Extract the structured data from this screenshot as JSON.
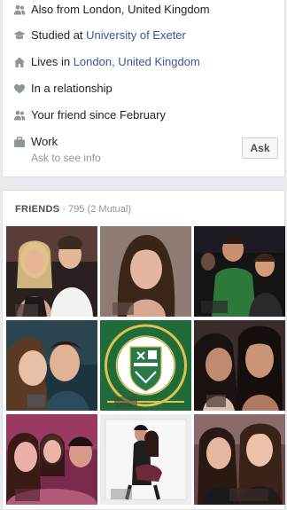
{
  "about": {
    "from_text": "Also from London, United Kingdom",
    "studied_prefix": "Studied at ",
    "studied_link": "University of Exeter",
    "lives_prefix": "Lives in ",
    "lives_link": "London, United Kingdom",
    "relationship": "In a relationship",
    "friend_since": "Your friend since February",
    "work_label": "Work",
    "work_sub": "Ask to see info",
    "ask_button": "Ask"
  },
  "icons": {
    "from": "people-icon",
    "studied": "graduation-cap-icon",
    "lives": "house-icon",
    "relationship": "heart-icon",
    "friend_since": "people-icon",
    "work": "briefcase-icon"
  },
  "friends": {
    "title": "FRIENDS",
    "separator": " · ",
    "count": "795 (2 Mutual)",
    "tiles": [
      {
        "name": "friend-photo"
      },
      {
        "name": "friend-photo"
      },
      {
        "name": "friend-photo"
      },
      {
        "name": "friend-photo"
      },
      {
        "name": "friend-photo"
      },
      {
        "name": "friend-photo"
      },
      {
        "name": "friend-photo"
      },
      {
        "name": "friend-photo"
      },
      {
        "name": "friend-photo"
      }
    ]
  },
  "colors": {
    "link": "#365899",
    "text": "#1d2129",
    "muted": "#90949c",
    "icon": "#90949c",
    "background": "#e9ebee"
  }
}
